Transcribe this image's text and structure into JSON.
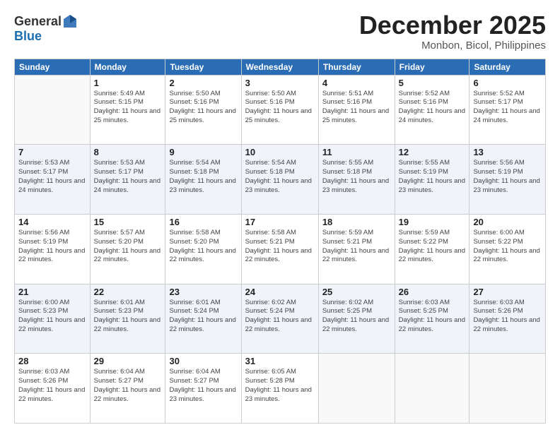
{
  "header": {
    "logo_general": "General",
    "logo_blue": "Blue",
    "month_title": "December 2025",
    "location": "Monbon, Bicol, Philippines"
  },
  "days_of_week": [
    "Sunday",
    "Monday",
    "Tuesday",
    "Wednesday",
    "Thursday",
    "Friday",
    "Saturday"
  ],
  "weeks": [
    [
      {
        "num": "",
        "sunrise": "",
        "sunset": "",
        "daylight": ""
      },
      {
        "num": "1",
        "sunrise": "Sunrise: 5:49 AM",
        "sunset": "Sunset: 5:15 PM",
        "daylight": "Daylight: 11 hours and 25 minutes."
      },
      {
        "num": "2",
        "sunrise": "Sunrise: 5:50 AM",
        "sunset": "Sunset: 5:16 PM",
        "daylight": "Daylight: 11 hours and 25 minutes."
      },
      {
        "num": "3",
        "sunrise": "Sunrise: 5:50 AM",
        "sunset": "Sunset: 5:16 PM",
        "daylight": "Daylight: 11 hours and 25 minutes."
      },
      {
        "num": "4",
        "sunrise": "Sunrise: 5:51 AM",
        "sunset": "Sunset: 5:16 PM",
        "daylight": "Daylight: 11 hours and 25 minutes."
      },
      {
        "num": "5",
        "sunrise": "Sunrise: 5:52 AM",
        "sunset": "Sunset: 5:16 PM",
        "daylight": "Daylight: 11 hours and 24 minutes."
      },
      {
        "num": "6",
        "sunrise": "Sunrise: 5:52 AM",
        "sunset": "Sunset: 5:17 PM",
        "daylight": "Daylight: 11 hours and 24 minutes."
      }
    ],
    [
      {
        "num": "7",
        "sunrise": "Sunrise: 5:53 AM",
        "sunset": "Sunset: 5:17 PM",
        "daylight": "Daylight: 11 hours and 24 minutes."
      },
      {
        "num": "8",
        "sunrise": "Sunrise: 5:53 AM",
        "sunset": "Sunset: 5:17 PM",
        "daylight": "Daylight: 11 hours and 24 minutes."
      },
      {
        "num": "9",
        "sunrise": "Sunrise: 5:54 AM",
        "sunset": "Sunset: 5:18 PM",
        "daylight": "Daylight: 11 hours and 23 minutes."
      },
      {
        "num": "10",
        "sunrise": "Sunrise: 5:54 AM",
        "sunset": "Sunset: 5:18 PM",
        "daylight": "Daylight: 11 hours and 23 minutes."
      },
      {
        "num": "11",
        "sunrise": "Sunrise: 5:55 AM",
        "sunset": "Sunset: 5:18 PM",
        "daylight": "Daylight: 11 hours and 23 minutes."
      },
      {
        "num": "12",
        "sunrise": "Sunrise: 5:55 AM",
        "sunset": "Sunset: 5:19 PM",
        "daylight": "Daylight: 11 hours and 23 minutes."
      },
      {
        "num": "13",
        "sunrise": "Sunrise: 5:56 AM",
        "sunset": "Sunset: 5:19 PM",
        "daylight": "Daylight: 11 hours and 23 minutes."
      }
    ],
    [
      {
        "num": "14",
        "sunrise": "Sunrise: 5:56 AM",
        "sunset": "Sunset: 5:19 PM",
        "daylight": "Daylight: 11 hours and 22 minutes."
      },
      {
        "num": "15",
        "sunrise": "Sunrise: 5:57 AM",
        "sunset": "Sunset: 5:20 PM",
        "daylight": "Daylight: 11 hours and 22 minutes."
      },
      {
        "num": "16",
        "sunrise": "Sunrise: 5:58 AM",
        "sunset": "Sunset: 5:20 PM",
        "daylight": "Daylight: 11 hours and 22 minutes."
      },
      {
        "num": "17",
        "sunrise": "Sunrise: 5:58 AM",
        "sunset": "Sunset: 5:21 PM",
        "daylight": "Daylight: 11 hours and 22 minutes."
      },
      {
        "num": "18",
        "sunrise": "Sunrise: 5:59 AM",
        "sunset": "Sunset: 5:21 PM",
        "daylight": "Daylight: 11 hours and 22 minutes."
      },
      {
        "num": "19",
        "sunrise": "Sunrise: 5:59 AM",
        "sunset": "Sunset: 5:22 PM",
        "daylight": "Daylight: 11 hours and 22 minutes."
      },
      {
        "num": "20",
        "sunrise": "Sunrise: 6:00 AM",
        "sunset": "Sunset: 5:22 PM",
        "daylight": "Daylight: 11 hours and 22 minutes."
      }
    ],
    [
      {
        "num": "21",
        "sunrise": "Sunrise: 6:00 AM",
        "sunset": "Sunset: 5:23 PM",
        "daylight": "Daylight: 11 hours and 22 minutes."
      },
      {
        "num": "22",
        "sunrise": "Sunrise: 6:01 AM",
        "sunset": "Sunset: 5:23 PM",
        "daylight": "Daylight: 11 hours and 22 minutes."
      },
      {
        "num": "23",
        "sunrise": "Sunrise: 6:01 AM",
        "sunset": "Sunset: 5:24 PM",
        "daylight": "Daylight: 11 hours and 22 minutes."
      },
      {
        "num": "24",
        "sunrise": "Sunrise: 6:02 AM",
        "sunset": "Sunset: 5:24 PM",
        "daylight": "Daylight: 11 hours and 22 minutes."
      },
      {
        "num": "25",
        "sunrise": "Sunrise: 6:02 AM",
        "sunset": "Sunset: 5:25 PM",
        "daylight": "Daylight: 11 hours and 22 minutes."
      },
      {
        "num": "26",
        "sunrise": "Sunrise: 6:03 AM",
        "sunset": "Sunset: 5:25 PM",
        "daylight": "Daylight: 11 hours and 22 minutes."
      },
      {
        "num": "27",
        "sunrise": "Sunrise: 6:03 AM",
        "sunset": "Sunset: 5:26 PM",
        "daylight": "Daylight: 11 hours and 22 minutes."
      }
    ],
    [
      {
        "num": "28",
        "sunrise": "Sunrise: 6:03 AM",
        "sunset": "Sunset: 5:26 PM",
        "daylight": "Daylight: 11 hours and 22 minutes."
      },
      {
        "num": "29",
        "sunrise": "Sunrise: 6:04 AM",
        "sunset": "Sunset: 5:27 PM",
        "daylight": "Daylight: 11 hours and 22 minutes."
      },
      {
        "num": "30",
        "sunrise": "Sunrise: 6:04 AM",
        "sunset": "Sunset: 5:27 PM",
        "daylight": "Daylight: 11 hours and 23 minutes."
      },
      {
        "num": "31",
        "sunrise": "Sunrise: 6:05 AM",
        "sunset": "Sunset: 5:28 PM",
        "daylight": "Daylight: 11 hours and 23 minutes."
      },
      {
        "num": "",
        "sunrise": "",
        "sunset": "",
        "daylight": ""
      },
      {
        "num": "",
        "sunrise": "",
        "sunset": "",
        "daylight": ""
      },
      {
        "num": "",
        "sunrise": "",
        "sunset": "",
        "daylight": ""
      }
    ]
  ]
}
